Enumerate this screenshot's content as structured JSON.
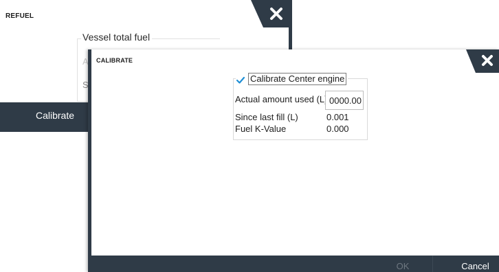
{
  "refuel": {
    "title": "REFUEL",
    "group_label": "Vessel total fuel",
    "field_a_partial": "A",
    "field_b_partial": "Se",
    "footer_button": "Calibrate"
  },
  "calibrate": {
    "title": "CALIBRATE",
    "checkbox_label": "Calibrate Center engine",
    "checkbox_checked": true,
    "rows": [
      {
        "label": "Actual amount used (L)",
        "value": "0000.00"
      },
      {
        "label": "Since last fill (L)",
        "value": "0.001"
      },
      {
        "label": "Fuel K-Value",
        "value": "0.000"
      }
    ],
    "ok_label": "OK",
    "cancel_label": "Cancel"
  },
  "colors": {
    "dark_navy": "#2f3b47",
    "check_blue": "#1e8fd6",
    "disabled_text": "#6e7780"
  },
  "icons": {
    "close": "close-icon",
    "check": "checkmark-icon"
  }
}
